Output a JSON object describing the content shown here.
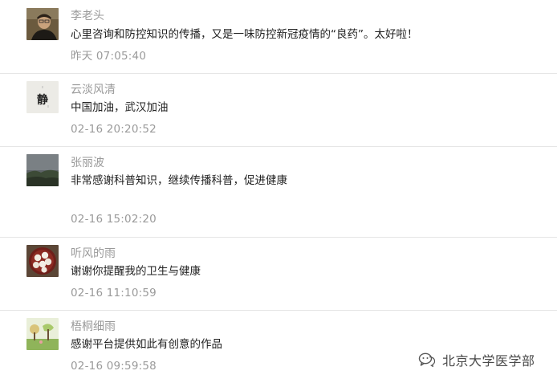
{
  "comments": [
    {
      "name": "李老头",
      "content": "心里咨询和防控知识的传播，又是一味防控新冠疫情的“良药”。太好啦！",
      "time": "昨天 07:05:40",
      "avatar": "portrait-avatar"
    },
    {
      "name": "云淡风清",
      "content": "中国加油，武汉加油",
      "time": "02-16 20:20:52",
      "avatar": "calligraphy-jing-avatar",
      "avatar_text": "静"
    },
    {
      "name": "张丽波",
      "content": "非常感谢科普知识，继续传播科普，促进健康",
      "time": "02-16 15:02:20",
      "avatar": "landscape-avatar"
    },
    {
      "name": "听风的雨",
      "content": "谢谢你提醒我的卫生与健康",
      "time": "02-16 11:10:59",
      "avatar": "dumplings-plate-avatar"
    },
    {
      "name": "梧桐细雨",
      "content": "感谢平台提供如此有创意的作品",
      "time": "02-16 09:59:58",
      "avatar": "nature-illustration-avatar"
    }
  ],
  "watermark": {
    "text": "北京大学医学部",
    "icon": "wechat-official-account-icon"
  },
  "colors": {
    "name": "#9a9a9a",
    "content": "#1f1f1f",
    "time": "#9a9a9a",
    "divider": "#e6e6e6"
  }
}
